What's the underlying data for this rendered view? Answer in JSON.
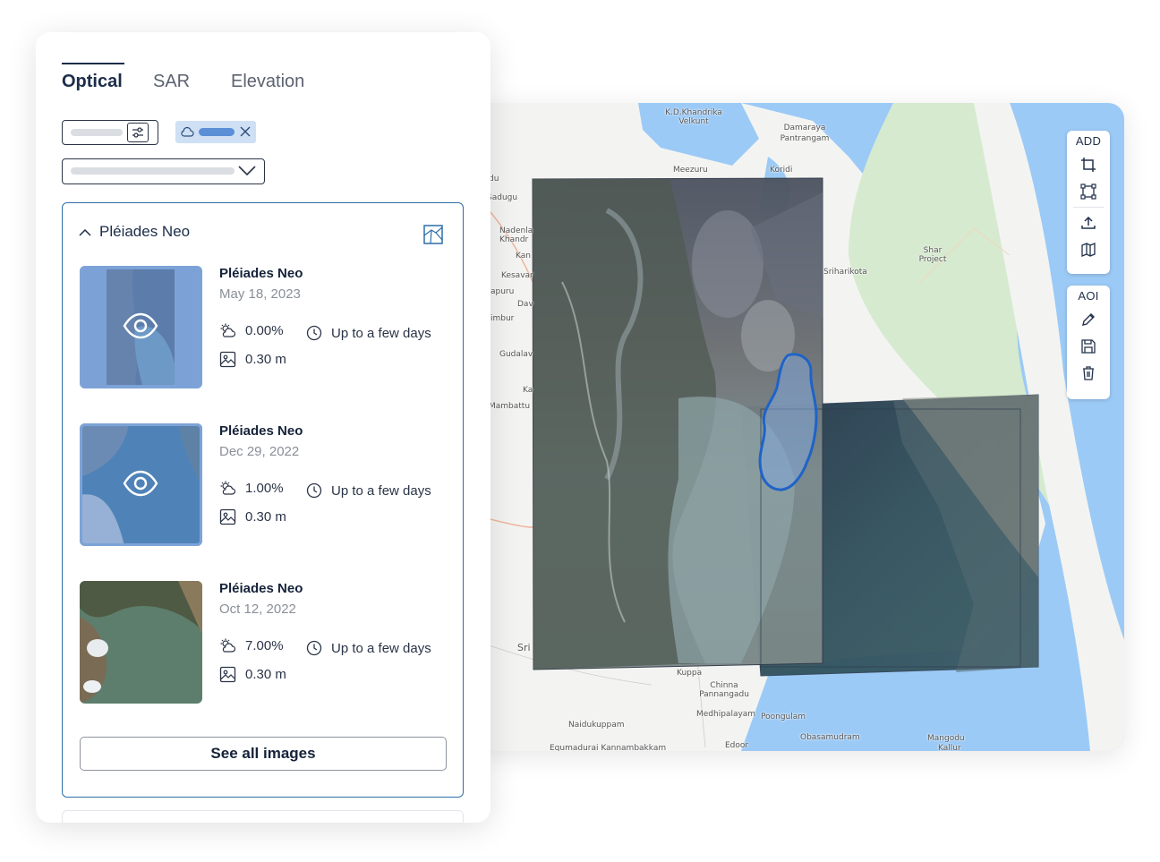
{
  "tabs": [
    {
      "label": "Optical",
      "active": true
    },
    {
      "label": "SAR",
      "active": false
    },
    {
      "label": "Elevation",
      "active": false
    }
  ],
  "group": {
    "title": "Pléiades Neo",
    "expanded": true
  },
  "images": [
    {
      "title": "Pléiades Neo",
      "date": "May 18, 2023",
      "cloud_cover": "0.00%",
      "delivery": "Up to a few days",
      "resolution": "0.30 m",
      "visible_on_map": true
    },
    {
      "title": "Pléiades Neo",
      "date": "Dec 29, 2022",
      "cloud_cover": "1.00%",
      "delivery": "Up to a few days",
      "resolution": "0.30 m",
      "visible_on_map": true
    },
    {
      "title": "Pléiades Neo",
      "date": "Oct 12, 2022",
      "cloud_cover": "7.00%",
      "delivery": "Up to a few days",
      "resolution": "0.30 m",
      "visible_on_map": false
    }
  ],
  "see_all_label": "See all images",
  "map": {
    "toolbar_add_label": "ADD",
    "toolbar_aoi_label": "AOI",
    "places": [
      "K.D.Khandrika Velkunt",
      "Damaraya Pantrangam",
      "Meezuru",
      "Koridi",
      "du",
      "Sadugu",
      "Nadenla Khandr",
      "Kan",
      "Kesavar",
      "apuru",
      "Dav",
      "imbur",
      "Gudalav",
      "Ka",
      "Mambattu",
      "Sriharikota",
      "Shar Project",
      "Sri",
      "Kuppa",
      "Chinna Pannangadu",
      "Naidukuppam",
      "Medhipalayam",
      "Poongulam",
      "Obasamudram",
      "Mangodu",
      "Edoor",
      "Equmadurai Kannambakkam",
      "Kallur"
    ]
  },
  "colors": {
    "accent": "#2f6fa8",
    "text_dark": "#15223a",
    "sea": "#9ccaf6",
    "land": "#f3f4f2",
    "forest": "#cfe6c3",
    "aoi_outline": "#1f63c7"
  }
}
